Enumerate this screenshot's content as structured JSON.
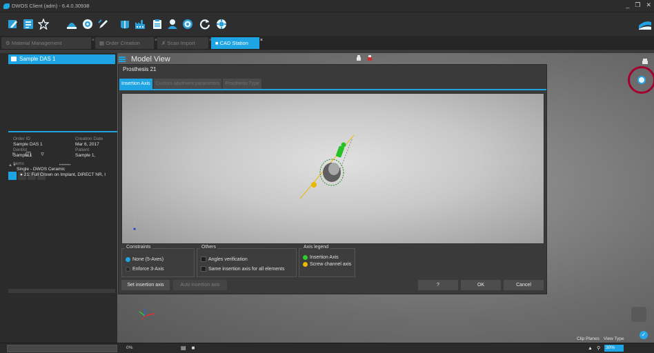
{
  "window": {
    "title": "DWOS Client (adm) - 6.4.0.30938",
    "controls": [
      "_",
      "❐",
      "✕"
    ]
  },
  "toolbar": {
    "icons": [
      "edit-icon",
      "layout-icon",
      "star-icon",
      "scan-icon",
      "target-icon",
      "cursor-icon",
      "half-icon",
      "factory-icon",
      "clipboard-icon",
      "user-icon",
      "settings-icon",
      "refresh-icon",
      "help-icon"
    ]
  },
  "tabs": [
    {
      "label": "Material Management",
      "active": false
    },
    {
      "label": "Order Creation",
      "active": false
    },
    {
      "label": "Scan Import",
      "active": false
    },
    {
      "label": "CAD Station",
      "active": true
    }
  ],
  "left_panel": {
    "case_name": "Sample DAS 1",
    "sort_label": "▲▼",
    "sort_dots": "••••••••",
    "order_id_label": "Order ID",
    "order_id": "Sample DAS 1",
    "creation_date_label": "Creation Date",
    "creation_date": "Mar 6, 2017",
    "dentist_label": "Dentist",
    "dentist": "Sample 1",
    "patient_label": "Patient",
    "patient": "Sample 1,",
    "items_label": "Items",
    "item_group": "Single - DWOS Ceramic",
    "item_line": "21: Full Crown on Implant, DIRECT NR, I"
  },
  "viewport": {
    "title": "Model View"
  },
  "dialog": {
    "title": "Prosthesis 21",
    "tabs": [
      {
        "label": "Insertion Axis",
        "active": true
      },
      {
        "label": "Custom abutment parameters",
        "active": false
      },
      {
        "label": "Prosthesis Type",
        "active": false
      }
    ],
    "constraints": {
      "title": "Constraints",
      "options": [
        {
          "label": "None (5-Axes)",
          "selected": true
        },
        {
          "label": "Enforce 3-Axis",
          "selected": false
        }
      ]
    },
    "others": {
      "title": "Others",
      "options": [
        {
          "label": "Angles verification",
          "checked": false
        },
        {
          "label": "Same insertion axis for all elements",
          "checked": false
        }
      ]
    },
    "legend": {
      "title": "Axis legend",
      "items": [
        {
          "label": "Insertion Axis",
          "color": "#2ecc2e"
        },
        {
          "label": "Screw channel axis",
          "color": "#e8b800"
        }
      ]
    },
    "buttons": {
      "set_axis": "Set insertion axis",
      "auto_axis": "Auto insertion axis",
      "help": "?",
      "ok": "OK",
      "cancel": "Cancel"
    }
  },
  "bottom": {
    "clip_planes": "Clip Planes",
    "view_type": "View Type",
    "progress_text": "0%",
    "zoom_value": "30%"
  },
  "colors": {
    "accent": "#1ea4e2",
    "highlight_ring": "#a3002d",
    "insertion_axis": "#2ecc2e",
    "screw_axis": "#e8b800"
  }
}
